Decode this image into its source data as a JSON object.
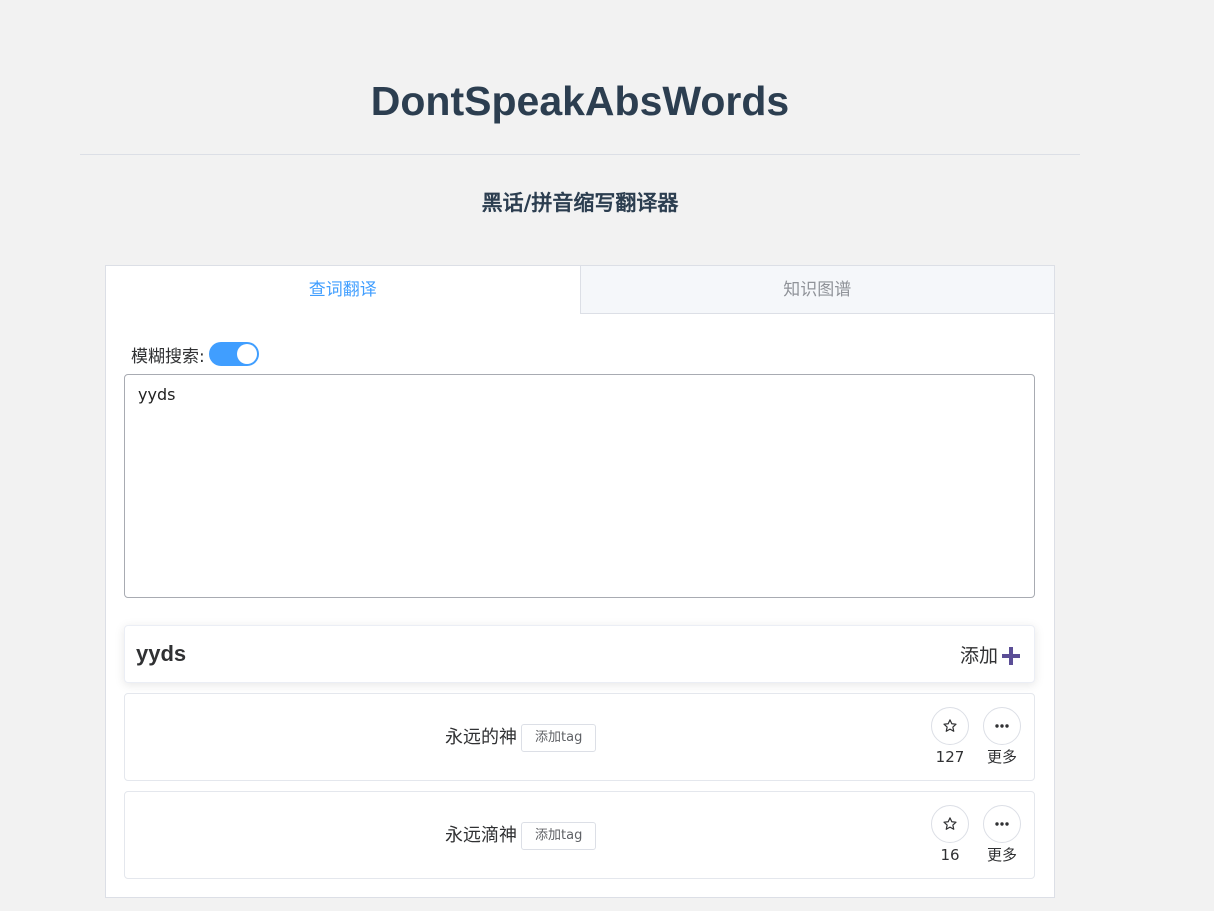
{
  "header": {
    "title": "DontSpeakAbsWords",
    "subtitle": "黑话/拼音缩写翻译器"
  },
  "tabs": [
    {
      "label": "查词翻译",
      "active": true
    },
    {
      "label": "知识图谱",
      "active": false
    }
  ],
  "search": {
    "fuzzy_label": "模糊搜索:",
    "fuzzy_enabled": true,
    "input_value": "yyds"
  },
  "result": {
    "word": "yyds",
    "add_label": "添加",
    "entries": [
      {
        "text": "永远的神",
        "tag_label": "添加tag",
        "likes": "127",
        "more_label": "更多"
      },
      {
        "text": "永远滴神",
        "tag_label": "添加tag",
        "likes": "16",
        "more_label": "更多"
      }
    ]
  },
  "colors": {
    "accent": "#409eff",
    "title": "#2c3e50",
    "plus": "#5b4e96"
  }
}
